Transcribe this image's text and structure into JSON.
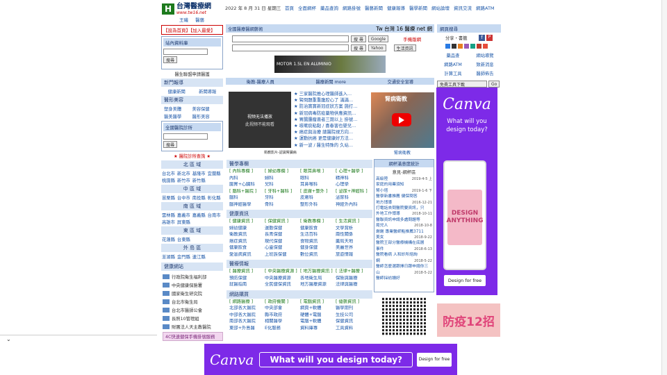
{
  "header": {
    "logo_title": "台灣醫療網",
    "logo_url": "www.tw16.net",
    "sub1": "王磯",
    "sub2": "醫藝",
    "date": "2022 年 8 月 31 日 星期三",
    "nav": [
      "首頁",
      "全面網杯",
      "藥品查詢",
      "網路掛號",
      "醫藝新聞",
      "健康報導",
      "醫學新聞",
      "網站論壇",
      "資訊交流",
      "網路ATM"
    ]
  },
  "left": {
    "topbar": "【設為首頁】【加入最愛】",
    "search_title": "站內資料庫",
    "search_btn": "搜尋",
    "member_link": "醫生聯盟申請醫護",
    "news_head": "新門報導",
    "news_items": [
      "健康新聞",
      "新聞導報"
    ],
    "beauty_head": "醫形美容",
    "beauty_items": [
      "塑身美體",
      "美容保健",
      "醫美醫學",
      "醫形美容"
    ],
    "hospital_head": "全國醫院診所",
    "hospital_btn": "搜尋",
    "hospital_link": "★ 醫院診所查詢 ★",
    "regions": [
      {
        "name": "北 區 域",
        "cities": [
          "台北市",
          "新北市",
          "基隆市",
          "宜蘭縣",
          "桃園縣",
          "新竹市",
          "新竹縣"
        ]
      },
      {
        "name": "中 區 域",
        "cities": [
          "苗栗縣",
          "台中市",
          "南投縣",
          "彰化縣"
        ]
      },
      {
        "name": "南 區 域",
        "cities": [
          "雲林縣",
          "嘉義市",
          "嘉義縣",
          "台南市",
          "高雄市",
          "屏東縣"
        ]
      },
      {
        "name": "東 區 域",
        "cities": [
          "花蓮縣",
          "台東縣"
        ]
      },
      {
        "name": "外 島 區",
        "cities": [
          "澎湖縣",
          "金門縣",
          "連江縣"
        ]
      }
    ],
    "links_head": "健康網站",
    "links": [
      "行政院衛生福利部",
      "中央健康保險署",
      "國家衛生研究院",
      "台北市衛生局",
      "台北市醫師公會",
      "長照10管理組",
      "財團法人天主教醫院",
      "4C快速健保手機掛號服務"
    ]
  },
  "center": {
    "search_btn1": "搜尋",
    "search_btn2": "搜尋",
    "google": "Google",
    "yahoo": "Yahoo",
    "select1": "搜 尋",
    "select2": "搜 尋",
    "tw_label": "Tw 台灣 16 醫療 net 網",
    "link_right1": "手機版網",
    "select_right": "生活資訊",
    "top_title": "全國醫療醫網藝術",
    "ad_text": "MOTOR 1.5L EN ALUMINIO",
    "tabs": [
      "衛教-醫療人員",
      "醫療新聞",
      "more",
      "交通安全宣導"
    ],
    "video_text1": "视频无法播放",
    "video_text2": "此视频不能观看",
    "video_caption": "衛教影片-認識腎臟病",
    "yt_caption": "腎病衛教",
    "news_list": [
      "三家醫院推心理醫師進入…",
      "腎問題重重腹腔心了 滿滿…",
      "防治寶寶新冠症狀方案 施打…",
      "新冠病毒防疫藥物供應資訊…",
      "胃腸腫瘤患者三期以上 掛號…",
      "咳嗽痰粘黏 / 喜春害也嬰兒…",
      "癌症與治療 總醫院視方向…",
      "運動抗癌 更是健康好方法…",
      "新一波 / 醫生特殊的 久站…"
    ],
    "med_head": "醫學專欄",
    "med_grid": [
      "[ 內科專欄 ]",
      "[ 婦幼專欄 ]",
      "[ 眼耳鼻喉 ]",
      "[ 心理+醫學 ]",
      "內科",
      "婦科",
      "眼科",
      "精神科",
      "腸胃+心臟科",
      "兒科",
      "耳鼻喉科",
      "心理學",
      "[ 腦科+醫院 ]",
      "[ 牙科+醫科 ]",
      "[ 皮膚+整外 ]",
      "[ 泌尿+神經科 ]",
      "腦科",
      "牙科",
      "皮膚科",
      "泌尿科",
      "腦神經醫學",
      "骨科",
      "整形外科",
      "神經外內科"
    ],
    "health_head": "健康資訊",
    "health_grid": [
      "[ 健康資訊 ]",
      "[ 保健資訊 ]",
      "[ 衛教專欄 ]",
      "[ 生活資訊 ]",
      "婦幼健康",
      "運動保健",
      "健康飲食",
      "文學賞析",
      "衛教資訊",
      "長青保健",
      "生活百科",
      "兩性關係",
      "癌症資訊",
      "現代保健",
      "食物資訊",
      "藥局天地",
      "健康飲食",
      "心靈保健",
      "健身保健",
      "美麗世界",
      "愛滋病資訊",
      "上班族保健",
      "數位資訊",
      "旅遊情報"
    ],
    "medinfo_head": "醫療情報",
    "medinfo_grid": [
      "[ 醫療資訊 ]",
      "[ 中央醫療資源 ]",
      "[ 地方醫療資訊 ]",
      "[ 法律+醫療 ]",
      "預防保健",
      "中央醫療資源",
      "各地衛生局",
      "保險與醫療",
      "就醫指南",
      "全民健保資訊",
      "地方醫療資源",
      "法律與醫療"
    ],
    "shop_head": "網路購買",
    "shop_grid": [
      "[ 網路醫療 ]",
      "[ 政府機關 ]",
      "[ 電腦資訊 ]",
      "[ 優藝資訊 ]",
      "北部各大醫院",
      "中央部會",
      "網頁+軟體",
      "醫學期刊",
      "中部各大醫院",
      "縣市政府",
      "硬體+電腦",
      "生技公司",
      "南部各大醫院",
      "相關醫學",
      "電腦+軟體",
      "保健資訊",
      "東部+外島醫",
      "E化服務",
      "資料庫專",
      "工具資料"
    ],
    "forum_title": "網杯滿意度統計",
    "forum_sub": "意見-網杯區",
    "forum_items": [
      {
        "t": "高級陸",
        "d": "2019-4-5 上"
      },
      {
        "t": "家庭的用藥須知",
        "d": ""
      },
      {
        "t": "腎小塔",
        "d": "2019-1-6 下"
      },
      {
        "t": "醫學新書推薦 健保問答",
        "d": ""
      },
      {
        "t": "地方博導",
        "d": "2016-12-21"
      },
      {
        "t": "打電話去問醫院要資訊，只",
        "d": ""
      },
      {
        "t": "外地工作博導",
        "d": "2018-10-11"
      },
      {
        "t": "醫聯資訊申請多處問題等",
        "d": ""
      },
      {
        "t": "局兒人",
        "d": "2018-10-8"
      },
      {
        "t": "謝謝 專業醫師點推薦3711",
        "d": ""
      },
      {
        "t": "美女",
        "d": "2018-9-22"
      },
      {
        "t": "醫院王部分醫療機構在底層",
        "d": ""
      },
      {
        "t": "事件",
        "d": "2018-6-13"
      },
      {
        "t": "醫院看病 人和診所諮詢",
        "d": ""
      },
      {
        "t": "網",
        "d": "2018-5-22"
      },
      {
        "t": "醫師怎麼選跟擇日跟申請你三",
        "d": ""
      },
      {
        "t": "山",
        "d": "2018-5-22"
      },
      {
        "t": "醫師採訪讀好",
        "d": ""
      }
    ]
  },
  "right": {
    "title": "網頁搜尋",
    "share": "分享・書籤",
    "fb": "f",
    "print": "P",
    "links": [
      "藥品查",
      "網站導覽",
      "網路ATM",
      "致新消息",
      "計算工具",
      "醫師佈告"
    ],
    "select_label": "免費工具下載",
    "go": "Go",
    "canva_logo": "Canva",
    "canva_tag": "What will you design today?",
    "canva_cta": "Design for free",
    "card_text": "DESIGN ANYTHING",
    "promo": "防疫12招"
  },
  "bottom_ad": {
    "logo": "Canva",
    "text": "What will you design today?",
    "cta": "Design for free"
  },
  "colors": {
    "accent": "#1a56a8",
    "header_bg": "#c6d9f1",
    "canva_purple": "#7d2ae8",
    "red": "#c00",
    "green": "#1d7a1d"
  }
}
